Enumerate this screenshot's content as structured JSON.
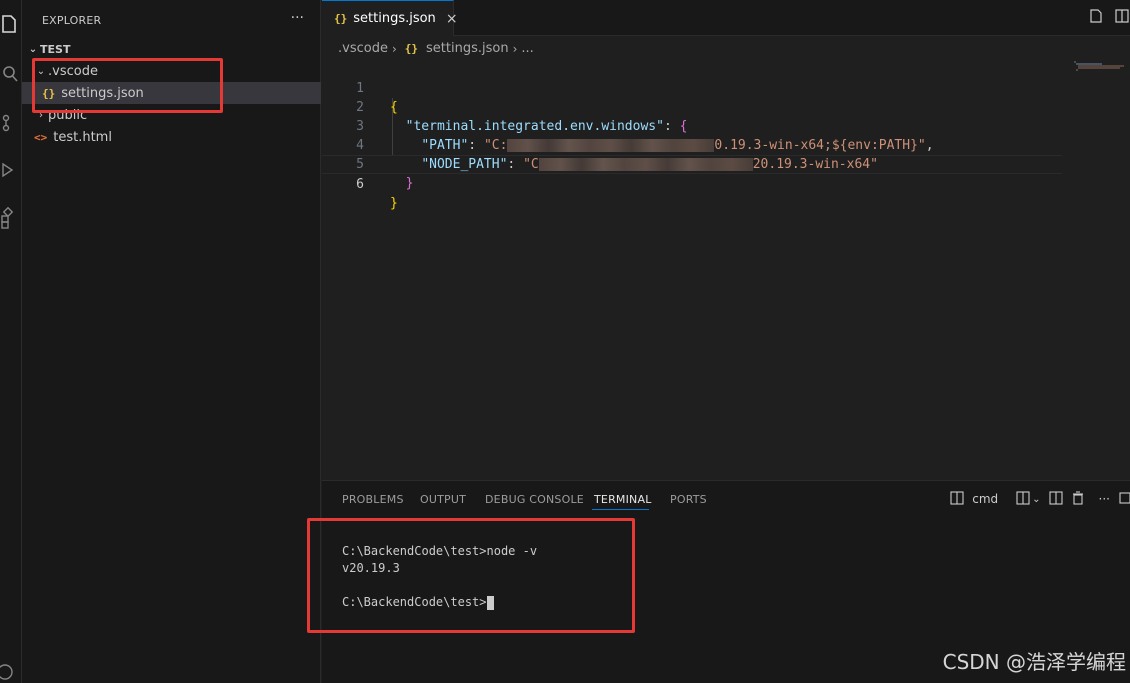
{
  "sidebar": {
    "header": "EXPLORER",
    "more": "···",
    "section": "TEST",
    "items": [
      {
        "label": ".vscode"
      },
      {
        "label": "settings.json"
      },
      {
        "label": "public"
      },
      {
        "label": "test.html"
      }
    ]
  },
  "editor": {
    "tab": {
      "label": "settings.json",
      "close": "×"
    },
    "breadcrumb": {
      "folder": ".vscode",
      "file": "settings.json",
      "more": "..."
    },
    "lines": {
      "l1_brace": "{",
      "l2_key": "\"terminal.integrated.env.windows\"",
      "l2_colon": ": ",
      "l2_brace": "{",
      "l3_key": "\"PATH\"",
      "l3_colon": ": ",
      "l3_start": "\"C:",
      "l3_end": "0.19.3-win-x64;${env:PATH}\"",
      "l3_comma": ",",
      "l4_key": "\"NODE_PATH\"",
      "l4_colon": ": ",
      "l4_start": "\"C",
      "l4_end": "20.19.3-win-x64\"",
      "l5_brace": "}",
      "l6_brace": "}"
    },
    "line_numbers": [
      "1",
      "2",
      "3",
      "4",
      "5",
      "6"
    ]
  },
  "panel": {
    "tabs": [
      "PROBLEMS",
      "OUTPUT",
      "DEBUG CONSOLE",
      "TERMINAL",
      "PORTS"
    ],
    "active_tab": "TERMINAL",
    "shell": "cmd",
    "terminal_lines": [
      "C:\\BackendCode\\test>node -v",
      "v20.19.3",
      "",
      "C:\\BackendCode\\test>"
    ]
  },
  "watermark": "CSDN @浩泽学编程",
  "colors": {
    "highlight_box": "#e53935",
    "accent": "#0078d4"
  }
}
